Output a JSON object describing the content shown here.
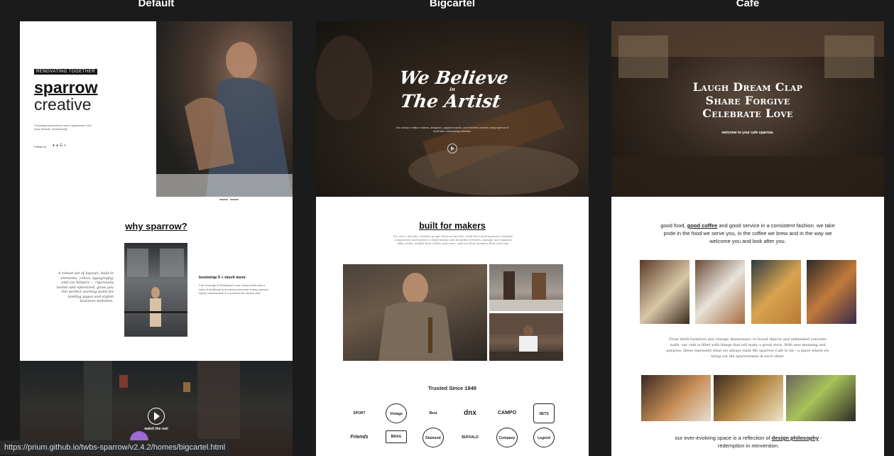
{
  "columns": [
    {
      "title": "Default"
    },
    {
      "title": "Bigcartel"
    },
    {
      "title": "Cafe"
    }
  ],
  "default": {
    "tag": "RENOVATING TOGETHER",
    "logo_line1": "sparrow",
    "logo_line2": "creative",
    "subtitle": "Creating marvelous user experience for your brand, seamlessly.",
    "follow_label": "Follow us",
    "social_icons": [
      "facebook-icon",
      "twitter-icon",
      "google-plus-icon"
    ],
    "why_title": "why sparrow?",
    "quote": "A robust set of layouts, built-in elements, colors, typography, and css helpers — rigorously tested and optimized, gives you the perfect starting point for landing pages and stylish business websites.",
    "feature_title": "bootstrap 5 + much more",
    "feature_text": "Full coverage of Bootstrap's core components plus a suite of additional time-saving elements makes sparrow highly customizable in a powerful but simple way.",
    "reel_label": "watch the reel"
  },
  "bigcartel": {
    "headline_1": "We Believe",
    "headline_in": "in",
    "headline_2": "The Artist",
    "hero_sub": "Join nearly a million makers, designers, apparel-brands, and business owners using sparrow to build their outstanding websites.",
    "section_title": "built for makers",
    "section_desc": "For over a decade, creative people from around the world have used sparrow's durable components and layouts to build unique and beautiful websites, manage and organize daily works, delight their clients and users, and run their business their own way.",
    "trusted_title": "Trusted Since 1849",
    "logos": [
      "SPORT",
      "Vintage",
      "Best",
      "dnx",
      "CAMPO",
      "NETS",
      "Friends",
      "BRAG",
      "Diamond",
      "BUFFALO",
      "Company",
      "Legend"
    ]
  },
  "cafe": {
    "headline": [
      "Laugh Dream Clap",
      "Share Forgive",
      "Celebrate Love"
    ],
    "welcome": "welcome to your cafe sparrow.",
    "intro_pre": "good food, ",
    "intro_link": "good coffee",
    "intro_post": " and good service in a consistent fashion. we take pride in the food we serve you, in the coffee we brew and in the way we welcome you and look after you.",
    "story": "From thrift furniture and vintage dinnerware, to found objects and unfinished concrete walls, our cafe is filled with things that tell many a great story. With new meaning and purpose, these represent what we always want My sparrow Cafe to be – a place where we bring out the sparrowness in each other.",
    "outro_pre": "our ever-evolving space is a reflection of ",
    "outro_link": "design philosophy",
    "outro_post": " - redemption in reinvention."
  },
  "status_url": "https://prium.github.io/twbs-sparrow/v2.4.2/homes/bigcartel.html"
}
